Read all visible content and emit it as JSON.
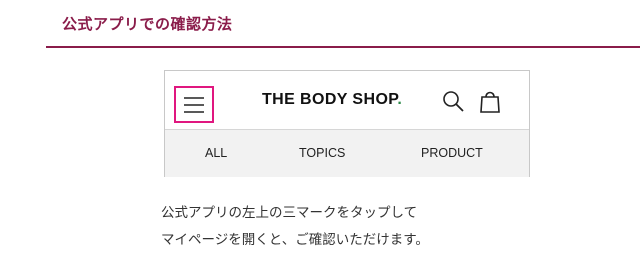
{
  "section": {
    "title": "公式アプリでの確認方法"
  },
  "colors": {
    "accent": "#8a1c4a",
    "highlight": "#e0177f",
    "brand_dot": "#2d8a4a"
  },
  "app_mock": {
    "menu_icon": "hamburger-menu-icon",
    "brand": {
      "name": "THE BODY SHOP",
      "dot": "."
    },
    "icons": [
      "search-icon",
      "bag-icon"
    ],
    "nav": [
      "ALL",
      "TOPICS",
      "PRODUCT"
    ]
  },
  "caption": {
    "line1": "公式アプリの左上の三マークをタップして",
    "line2": "マイページを開くと、ご確認いただけます。"
  }
}
